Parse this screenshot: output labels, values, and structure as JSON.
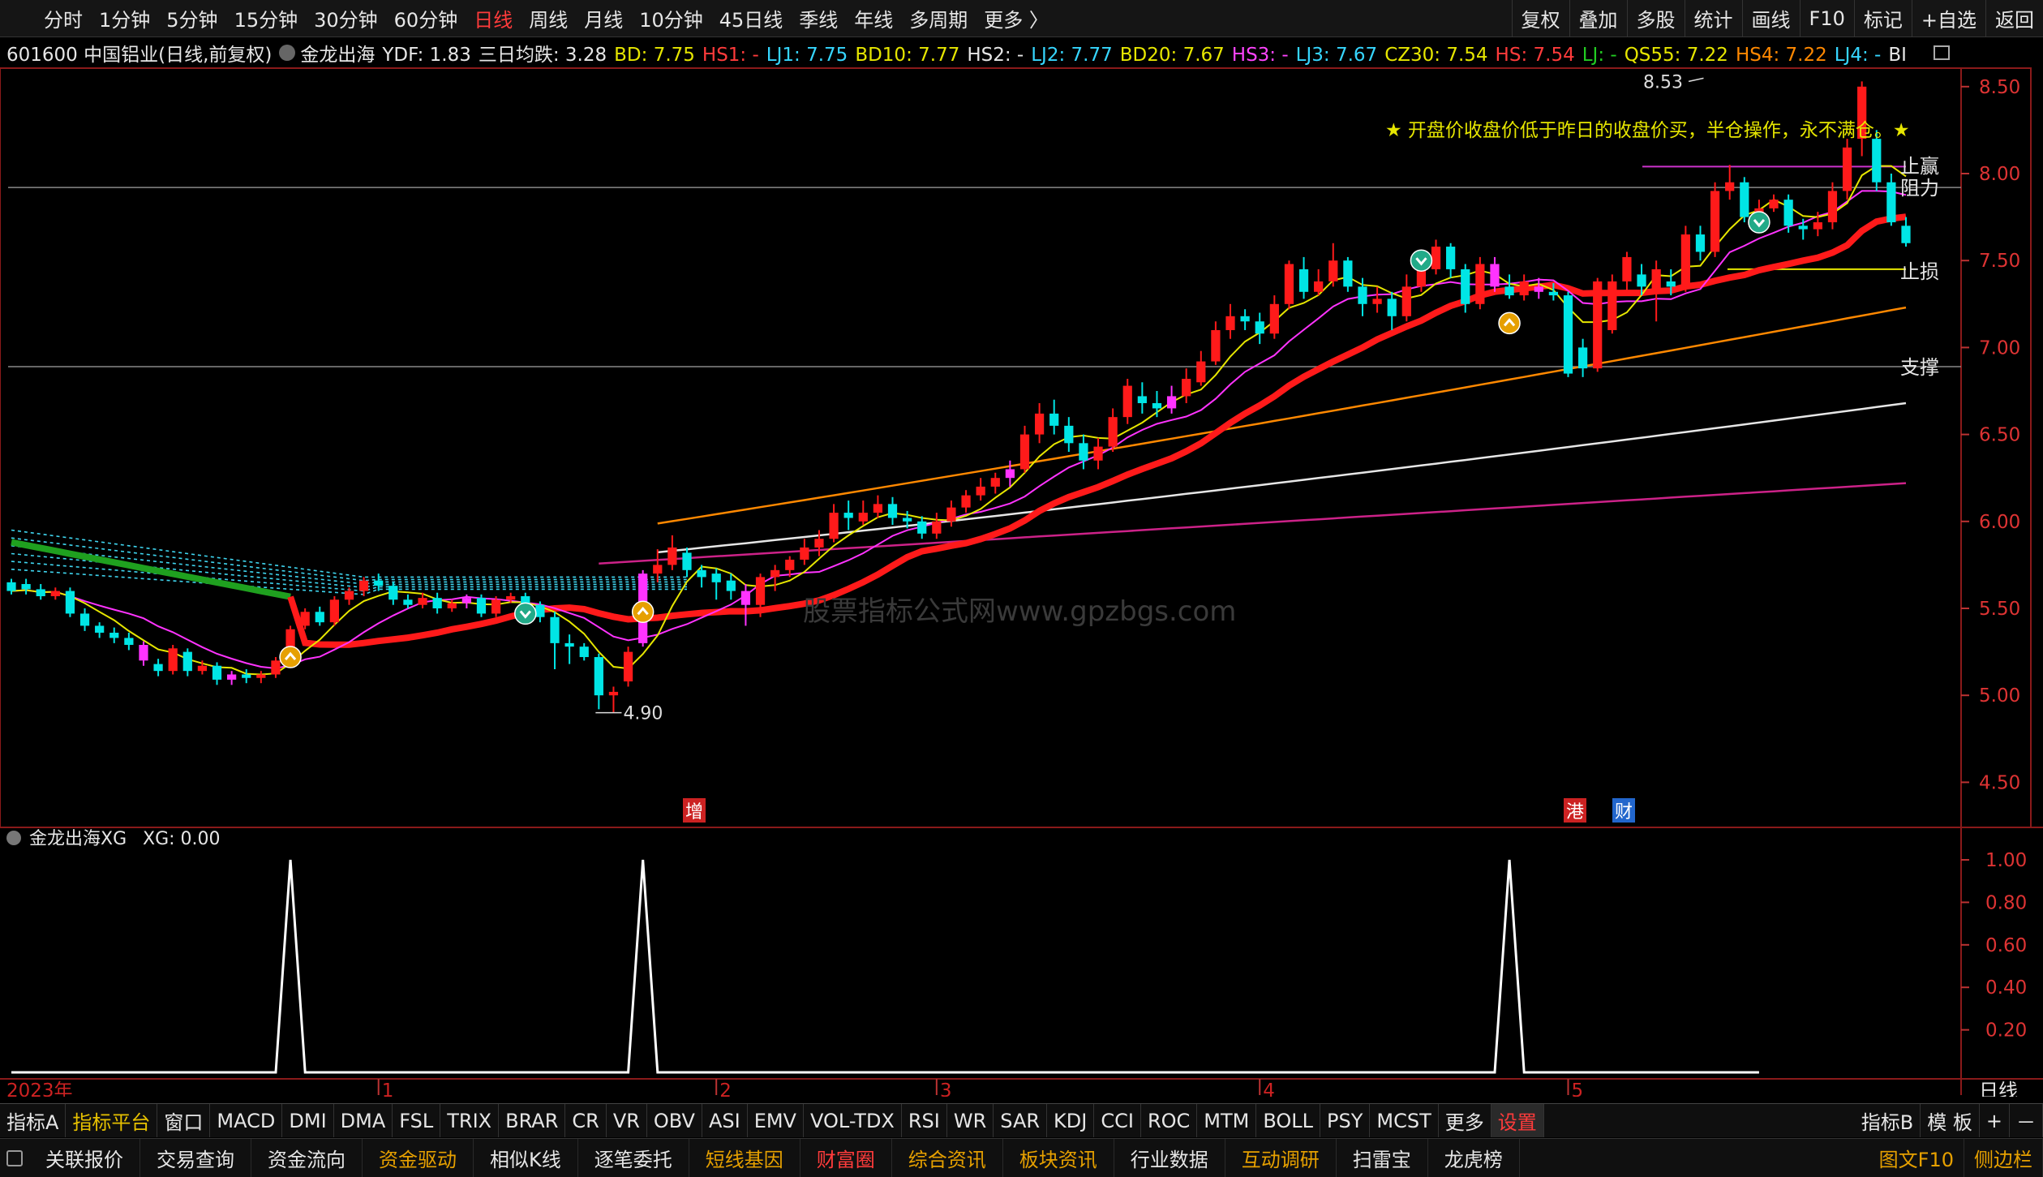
{
  "toolbar": {
    "periods": [
      "分时",
      "1分钟",
      "5分钟",
      "15分钟",
      "30分钟",
      "60分钟",
      "日线",
      "周线",
      "月线",
      "10分钟",
      "45日线",
      "季线",
      "年线",
      "多周期",
      "更多 〉"
    ],
    "active_period": "日线",
    "tools": [
      "复权",
      "叠加",
      "多股",
      "统计",
      "画线",
      "F10",
      "标记",
      "+自选",
      "返回"
    ]
  },
  "infobar": {
    "stock": "601600 中国铝业(日线,前复权)",
    "formula": "金龙出海",
    "items": [
      {
        "t": "YDF: 1.83",
        "c": "#e6e6e6"
      },
      {
        "t": "三日均跌: 3.28",
        "c": "#e6e6e6"
      },
      {
        "t": "BD: 7.75",
        "c": "#e6e600"
      },
      {
        "t": "HS1: -",
        "c": "#ff3b3b"
      },
      {
        "t": "LJ1: 7.75",
        "c": "#36d6ff"
      },
      {
        "t": "BD10: 7.77",
        "c": "#e6e600"
      },
      {
        "t": "HS2: -",
        "c": "#e6e6e6"
      },
      {
        "t": "LJ2: 7.77",
        "c": "#36d6ff"
      },
      {
        "t": "BD20: 7.67",
        "c": "#e6e600"
      },
      {
        "t": "HS3: -",
        "c": "#ff44ff"
      },
      {
        "t": "LJ3: 7.67",
        "c": "#36d6ff"
      },
      {
        "t": "CZ30: 7.54",
        "c": "#e6e600"
      },
      {
        "t": "HS: 7.54",
        "c": "#ff3b3b"
      },
      {
        "t": "LJ: -",
        "c": "#22cc22"
      },
      {
        "t": "QS55: 7.22",
        "c": "#e6e600"
      },
      {
        "t": "HS4: 7.22",
        "c": "#ff8800"
      },
      {
        "t": "LJ4: -",
        "c": "#36d6ff"
      },
      {
        "t": "BI",
        "c": "#e6e6e6"
      }
    ]
  },
  "chart": {
    "yticks": [
      "8.50",
      "8.00",
      "7.50",
      "7.00",
      "6.50",
      "6.00",
      "5.50",
      "5.00",
      "4.50"
    ],
    "note": "★ 开盘价收盘价低于昨日的收盘价买，半仓操作，永不满仓。★",
    "watermark": "股票指标公式网www.gpzbgs.com",
    "high_label": "8.53",
    "low_label": "4.90",
    "level_labels": [
      "止赢",
      "阻力",
      "止损",
      "支撑"
    ],
    "event_marks": [
      "增",
      "港",
      "财"
    ],
    "candles": [
      [
        5.65,
        5.6,
        5.67,
        5.58
      ],
      [
        5.64,
        5.61,
        5.67,
        5.58
      ],
      [
        5.61,
        5.57,
        5.64,
        5.55
      ],
      [
        5.57,
        5.6,
        5.62,
        5.55
      ],
      [
        5.6,
        5.47,
        5.62,
        5.45
      ],
      [
        5.47,
        5.4,
        5.5,
        5.37
      ],
      [
        5.4,
        5.36,
        5.42,
        5.33
      ],
      [
        5.36,
        5.33,
        5.39,
        5.3
      ],
      [
        5.33,
        5.29,
        5.36,
        5.26
      ],
      [
        5.29,
        5.2,
        5.31,
        5.17
      ],
      [
        5.18,
        5.14,
        5.21,
        5.11
      ],
      [
        5.14,
        5.27,
        5.29,
        5.12
      ],
      [
        5.25,
        5.14,
        5.27,
        5.11
      ],
      [
        5.14,
        5.17,
        5.2,
        5.12
      ],
      [
        5.17,
        5.09,
        5.19,
        5.06
      ],
      [
        5.09,
        5.12,
        5.14,
        5.06
      ],
      [
        5.12,
        5.1,
        5.15,
        5.07
      ],
      [
        5.1,
        5.12,
        5.14,
        5.07
      ],
      [
        5.12,
        5.2,
        5.22,
        5.1
      ],
      [
        5.2,
        5.38,
        5.4,
        5.19
      ],
      [
        5.4,
        5.48,
        5.5,
        5.38
      ],
      [
        5.48,
        5.42,
        5.51,
        5.4
      ],
      [
        5.42,
        5.55,
        5.57,
        5.4
      ],
      [
        5.55,
        5.6,
        5.62,
        5.52
      ],
      [
        5.6,
        5.66,
        5.68,
        5.57
      ],
      [
        5.66,
        5.63,
        5.7,
        5.6
      ],
      [
        5.63,
        5.55,
        5.65,
        5.52
      ],
      [
        5.55,
        5.52,
        5.58,
        5.5
      ],
      [
        5.52,
        5.56,
        5.59,
        5.5
      ],
      [
        5.56,
        5.5,
        5.59,
        5.47
      ],
      [
        5.5,
        5.53,
        5.55,
        5.48
      ],
      [
        5.53,
        5.56,
        5.58,
        5.5
      ],
      [
        5.56,
        5.47,
        5.58,
        5.45
      ],
      [
        5.47,
        5.55,
        5.57,
        5.45
      ],
      [
        5.55,
        5.57,
        5.59,
        5.53
      ],
      [
        5.57,
        5.52,
        5.59,
        5.5
      ],
      [
        5.52,
        5.45,
        5.54,
        5.42
      ],
      [
        5.45,
        5.3,
        5.48,
        5.15
      ],
      [
        5.3,
        5.28,
        5.35,
        5.18
      ],
      [
        5.28,
        5.22,
        5.3,
        5.2
      ],
      [
        5.22,
        5.0,
        5.24,
        4.92
      ],
      [
        5.0,
        5.02,
        5.05,
        4.9
      ],
      [
        5.08,
        5.25,
        5.28,
        5.05
      ],
      [
        5.3,
        5.7,
        5.72,
        5.28
      ],
      [
        5.7,
        5.75,
        5.84,
        5.65
      ],
      [
        5.75,
        5.85,
        5.92,
        5.72
      ],
      [
        5.82,
        5.72,
        5.85,
        5.68
      ],
      [
        5.72,
        5.68,
        5.75,
        5.62
      ],
      [
        5.7,
        5.65,
        5.73,
        5.55
      ],
      [
        5.66,
        5.6,
        5.7,
        5.55
      ],
      [
        5.6,
        5.52,
        5.64,
        5.4
      ],
      [
        5.52,
        5.68,
        5.7,
        5.45
      ],
      [
        5.68,
        5.72,
        5.75,
        5.6
      ],
      [
        5.72,
        5.78,
        5.8,
        5.68
      ],
      [
        5.78,
        5.85,
        5.9,
        5.75
      ],
      [
        5.85,
        5.9,
        5.95,
        5.8
      ],
      [
        5.9,
        6.05,
        6.1,
        5.88
      ],
      [
        6.05,
        6.02,
        6.12,
        5.95
      ],
      [
        6.0,
        6.05,
        6.12,
        5.98
      ],
      [
        6.05,
        6.1,
        6.15,
        6.02
      ],
      [
        6.1,
        6.02,
        6.14,
        5.98
      ],
      [
        6.02,
        6.0,
        6.06,
        5.96
      ],
      [
        6.0,
        5.93,
        6.03,
        5.9
      ],
      [
        5.93,
        6.0,
        6.05,
        5.9
      ],
      [
        6.0,
        6.08,
        6.12,
        5.97
      ],
      [
        6.08,
        6.15,
        6.18,
        6.05
      ],
      [
        6.15,
        6.2,
        6.25,
        6.12
      ],
      [
        6.2,
        6.25,
        6.28,
        6.16
      ],
      [
        6.25,
        6.3,
        6.35,
        6.2
      ],
      [
        6.3,
        6.5,
        6.55,
        6.28
      ],
      [
        6.5,
        6.62,
        6.68,
        6.45
      ],
      [
        6.62,
        6.55,
        6.7,
        6.5
      ],
      [
        6.55,
        6.45,
        6.6,
        6.4
      ],
      [
        6.45,
        6.35,
        6.5,
        6.3
      ],
      [
        6.35,
        6.43,
        6.48,
        6.3
      ],
      [
        6.43,
        6.6,
        6.65,
        6.4
      ],
      [
        6.6,
        6.78,
        6.82,
        6.56
      ],
      [
        6.72,
        6.68,
        6.8,
        6.62
      ],
      [
        6.68,
        6.65,
        6.75,
        6.6
      ],
      [
        6.65,
        6.72,
        6.78,
        6.62
      ],
      [
        6.72,
        6.82,
        6.88,
        6.68
      ],
      [
        6.8,
        6.92,
        6.98,
        6.78
      ],
      [
        6.92,
        7.1,
        7.15,
        6.9
      ],
      [
        7.1,
        7.18,
        7.25,
        7.05
      ],
      [
        7.18,
        7.15,
        7.22,
        7.1
      ],
      [
        7.15,
        7.08,
        7.2,
        7.02
      ],
      [
        7.08,
        7.25,
        7.3,
        7.05
      ],
      [
        7.25,
        7.48,
        7.5,
        7.22
      ],
      [
        7.45,
        7.32,
        7.52,
        7.28
      ],
      [
        7.32,
        7.38,
        7.45,
        7.3
      ],
      [
        7.38,
        7.5,
        7.6,
        7.35
      ],
      [
        7.5,
        7.35,
        7.52,
        7.32
      ],
      [
        7.35,
        7.25,
        7.4,
        7.18
      ],
      [
        7.25,
        7.28,
        7.35,
        7.2
      ],
      [
        7.28,
        7.18,
        7.32,
        7.1
      ],
      [
        7.18,
        7.35,
        7.42,
        7.15
      ],
      [
        7.35,
        7.45,
        7.55,
        7.32
      ],
      [
        7.45,
        7.58,
        7.62,
        7.42
      ],
      [
        7.58,
        7.45,
        7.6,
        7.4
      ],
      [
        7.45,
        7.25,
        7.48,
        7.2
      ],
      [
        7.25,
        7.48,
        7.52,
        7.22
      ],
      [
        7.48,
        7.35,
        7.52,
        7.32
      ],
      [
        7.35,
        7.3,
        7.42,
        7.28
      ],
      [
        7.3,
        7.38,
        7.42,
        7.27
      ],
      [
        7.35,
        7.32,
        7.4,
        7.28
      ],
      [
        7.32,
        7.3,
        7.37,
        7.27
      ],
      [
        7.3,
        6.85,
        7.32,
        6.83
      ],
      [
        7.0,
        6.88,
        7.05,
        6.83
      ],
      [
        6.88,
        7.38,
        7.4,
        6.86
      ],
      [
        7.1,
        7.38,
        7.42,
        7.08
      ],
      [
        7.38,
        7.52,
        7.55,
        7.32
      ],
      [
        7.42,
        7.35,
        7.48,
        7.3
      ],
      [
        7.32,
        7.45,
        7.5,
        7.15
      ],
      [
        7.38,
        7.35,
        7.45,
        7.3
      ],
      [
        7.35,
        7.65,
        7.7,
        7.32
      ],
      [
        7.65,
        7.55,
        7.7,
        7.5
      ],
      [
        7.55,
        7.9,
        7.95,
        7.52
      ],
      [
        7.9,
        7.95,
        8.05,
        7.85
      ],
      [
        7.95,
        7.75,
        7.98,
        7.72
      ],
      [
        7.75,
        7.8,
        7.85,
        7.7
      ],
      [
        7.8,
        7.85,
        7.88,
        7.78
      ],
      [
        7.85,
        7.7,
        7.88,
        7.66
      ],
      [
        7.7,
        7.68,
        7.74,
        7.62
      ],
      [
        7.68,
        7.72,
        7.78,
        7.64
      ],
      [
        7.72,
        7.9,
        7.95,
        7.68
      ],
      [
        7.9,
        8.15,
        8.2,
        7.85
      ],
      [
        8.2,
        8.5,
        8.53,
        8.1
      ],
      [
        8.2,
        7.95,
        8.25,
        7.9
      ],
      [
        7.95,
        7.72,
        8.0,
        7.7
      ],
      [
        7.7,
        7.6,
        7.75,
        7.58
      ]
    ],
    "candle_colors": {
      "up": "#ff1a1a",
      "down": "#00e5e5",
      "signal": "#ff33ff"
    },
    "ma_colors": {
      "fast": "#e6e600",
      "mid": "#ff33ff",
      "thick": "#ff1a1a",
      "ma55": "#ff8800",
      "ma120": "#e6e6e6",
      "ma250": "#cc2288",
      "band": "#3fd6f0",
      "green_line": "#1fa01f"
    }
  },
  "sub": {
    "title": "金龙出海XG",
    "value": "XG: 0.00",
    "yticks": [
      "1.00",
      "0.80",
      "0.60",
      "0.40",
      "0.20"
    ],
    "signal_days": [
      19,
      43,
      102
    ],
    "xg": [
      0,
      0,
      0,
      0,
      0,
      0,
      0,
      0,
      0,
      0,
      0,
      0,
      0,
      0,
      0,
      0,
      0,
      0,
      0,
      1,
      0,
      0,
      0,
      0,
      0,
      0,
      0,
      0,
      0,
      0,
      0,
      0,
      0,
      0,
      0,
      0,
      0,
      0,
      0,
      0,
      0,
      0,
      0,
      1,
      0,
      0,
      0,
      0,
      0,
      0,
      0,
      0,
      0,
      0,
      0,
      0,
      0,
      0,
      0,
      0,
      0,
      0,
      0,
      0,
      0,
      0,
      0,
      0,
      0,
      0,
      0,
      0,
      0,
      0,
      0,
      0,
      0,
      0,
      0,
      0,
      0,
      0,
      0,
      0,
      0,
      0,
      0,
      0,
      0,
      0,
      0,
      0,
      0,
      0,
      0,
      0,
      0,
      0,
      0,
      0,
      0,
      0,
      1,
      0,
      0,
      0,
      0,
      0,
      0,
      0,
      0,
      0,
      0,
      0,
      0,
      0,
      0,
      0,
      0,
      0
    ]
  },
  "xaxis": {
    "labels": [
      {
        "t": "2023年",
        "i": 0
      },
      {
        "t": "1",
        "i": 25
      },
      {
        "t": "2",
        "i": 48
      },
      {
        "t": "3",
        "i": 63
      },
      {
        "t": "4",
        "i": 85
      },
      {
        "t": "5",
        "i": 106
      }
    ],
    "period_label": "日线"
  },
  "tabs1": {
    "items": [
      "指标A",
      "指标平台",
      "窗口",
      "MACD",
      "DMI",
      "DMA",
      "FSL",
      "TRIX",
      "BRAR",
      "CR",
      "VR",
      "OBV",
      "ASI",
      "EMV",
      "VOL-TDX",
      "RSI",
      "WR",
      "SAR",
      "KDJ",
      "CCI",
      "ROC",
      "MTM",
      "BOLL",
      "PSY",
      "MCST",
      "更多",
      "设置"
    ],
    "right": [
      "指标B",
      "模 板",
      "+",
      "－"
    ]
  },
  "tabs2": {
    "items": [
      {
        "t": "关联报价",
        "c": "#e6e6e6"
      },
      {
        "t": "交易查询",
        "c": "#e6e6e6"
      },
      {
        "t": "资金流向",
        "c": "#e6e6e6"
      },
      {
        "t": "资金驱动",
        "c": "#e6a000"
      },
      {
        "t": "相似K线",
        "c": "#e6e6e6"
      },
      {
        "t": "逐笔委托",
        "c": "#e6e6e6"
      },
      {
        "t": "短线基因",
        "c": "#e6a000"
      },
      {
        "t": "财富圈",
        "c": "#ff3b3b"
      },
      {
        "t": "综合资讯",
        "c": "#e6a000"
      },
      {
        "t": "板块资讯",
        "c": "#e6a000"
      },
      {
        "t": "行业数据",
        "c": "#e6e6e6"
      },
      {
        "t": "互动调研",
        "c": "#e6a000"
      },
      {
        "t": "扫雷宝",
        "c": "#e6e6e6"
      },
      {
        "t": "龙虎榜",
        "c": "#e6e6e6"
      }
    ],
    "right": [
      {
        "t": "图文F10",
        "c": "#e6a000"
      },
      {
        "t": "侧边栏",
        "c": "#e6a000"
      }
    ]
  }
}
